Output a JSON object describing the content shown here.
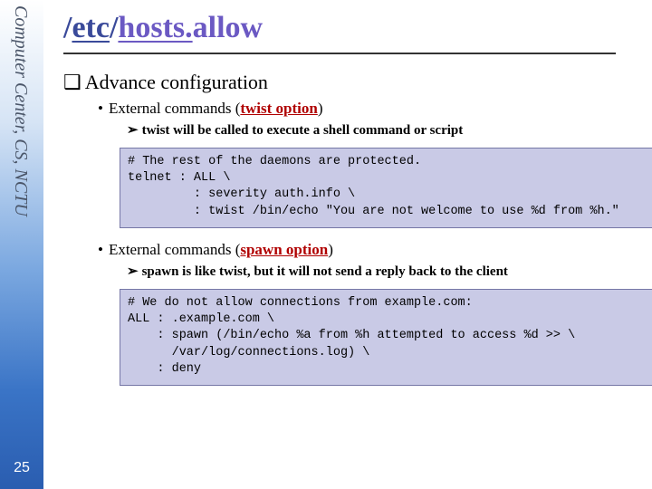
{
  "sidebar": {
    "label": "Computer Center, CS, NCTU"
  },
  "page_number": "25",
  "title": {
    "slash1": "/",
    "etc": "etc",
    "slash2": "/",
    "hosts": "hosts.",
    "allow": "allow"
  },
  "section_heading": "Advance configuration",
  "twist": {
    "bullet_prefix": "External commands (",
    "keyword": "twist option",
    "bullet_suffix": ")",
    "sub": "twist will be called to execute a shell command or script",
    "code": "# The rest of the daemons are protected.\ntelnet : ALL \\\n         : severity auth.info \\\n         : twist /bin/echo \"You are not welcome to use %d from %h.\""
  },
  "spawn": {
    "bullet_prefix": "External commands (",
    "keyword": "spawn option",
    "bullet_suffix": ")",
    "sub": "spawn is like twist, but it will not send a reply back to the client",
    "code": "# We do not allow connections from example.com:\nALL : .example.com \\\n    : spawn (/bin/echo %a from %h attempted to access %d >> \\\n      /var/log/connections.log) \\\n    : deny"
  }
}
